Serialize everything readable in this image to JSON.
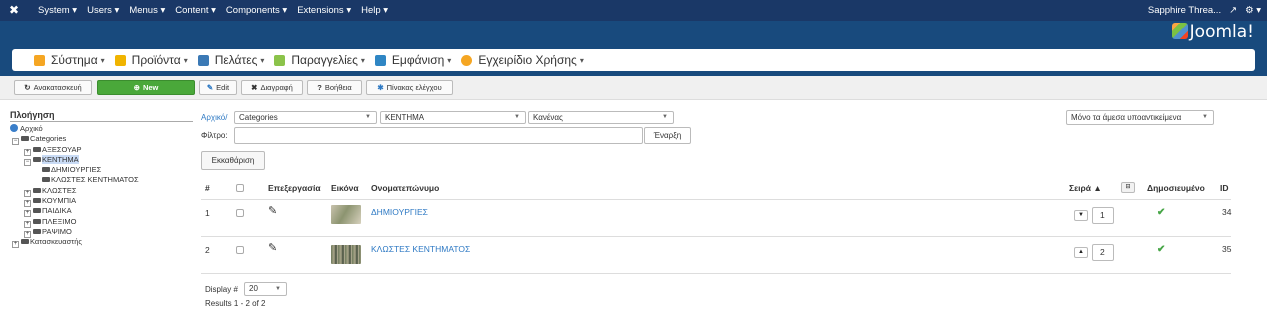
{
  "topbar": {
    "menu": [
      "System ▾",
      "Users ▾",
      "Menus ▾",
      "Content ▾",
      "Components ▾",
      "Extensions ▾",
      "Help ▾"
    ],
    "site_name": "Sapphire Threa...",
    "external_icon": "↗",
    "gear": "⚙ ▾"
  },
  "brand": {
    "name": "Joomla!"
  },
  "nav": {
    "items": [
      {
        "label": "Σύστημα",
        "icon_color": "#f5a623"
      },
      {
        "label": "Προϊόντα",
        "icon_color": "#f0b400"
      },
      {
        "label": "Πελάτες",
        "icon_color": "#3b79b5"
      },
      {
        "label": "Παραγγελίες",
        "icon_color": "#8bc34a"
      },
      {
        "label": "Εμφάνιση",
        "icon_color": "#2f86c4"
      },
      {
        "label": "Εγχειρίδιο Χρήσης",
        "icon_color": "#f5a623"
      }
    ]
  },
  "toolbar": {
    "rebuild": "Ανακατασκευή",
    "new": "New",
    "edit": "Edit",
    "delete": "Διαγραφή",
    "help": "Βοήθεια",
    "control_panel": "Πίνακας ελέγχου"
  },
  "sidebar": {
    "title": "Πλοήγηση",
    "tree": [
      {
        "label": "Αρχικό",
        "depth": 0,
        "type": "globe"
      },
      {
        "label": "Categories",
        "depth": 0,
        "type": "minus"
      },
      {
        "label": "ΑΞΕΣΟΥΑΡ",
        "depth": 1,
        "type": "plus"
      },
      {
        "label": "ΚΕΝΤΗΜΑ",
        "depth": 1,
        "type": "minus",
        "selected": true
      },
      {
        "label": "ΔΗΜΙΟΥΡΓΙΕΣ",
        "depth": 2,
        "type": "leaf"
      },
      {
        "label": "ΚΛΩΣΤΕΣ ΚΕΝΤΗΜΑΤΟΣ",
        "depth": 2,
        "type": "leaf"
      },
      {
        "label": "ΚΛΩΣΤΕΣ",
        "depth": 1,
        "type": "plus"
      },
      {
        "label": "ΚΟΥΜΠΙΑ",
        "depth": 1,
        "type": "plus"
      },
      {
        "label": "ΠΑΙΔΙΚΑ",
        "depth": 1,
        "type": "plus"
      },
      {
        "label": "ΠΛΕΞΙΜΟ",
        "depth": 1,
        "type": "plus"
      },
      {
        "label": "ΡΑΨΙΜΟ",
        "depth": 1,
        "type": "plus"
      },
      {
        "label": "Κατασκευαστής",
        "depth": 0,
        "type": "plus"
      }
    ]
  },
  "filters": {
    "breadcrumb_link": "Αρχικό/",
    "select1": "Categories",
    "select2": "ΚΕΝΤΗΜΑ",
    "select3": "Κανένας",
    "filter_label": "Φίλτρο:",
    "filter_value": "",
    "go": "Έναρξη",
    "clear": "Εκκαθάριση",
    "only_direct": "Μόνο τα άμεσα υποαντικείμενα"
  },
  "table": {
    "headers": {
      "num": "#",
      "edit": "Επεξεργασία",
      "image": "Εικόνα",
      "name": "Ονοματεπώνυμο",
      "order": "Σειρά",
      "published": "Δημοσιευμένο",
      "id": "ID"
    },
    "rows": [
      {
        "num": "1",
        "name": "ΔΗΜΙΟΥΡΓΙΕΣ",
        "order": "1",
        "id": "34",
        "order_arrow": "▼"
      },
      {
        "num": "2",
        "name": "ΚΛΩΣΤΕΣ ΚΕΝΤΗΜΑΤΟΣ",
        "order": "2",
        "id": "35",
        "order_arrow": "▲"
      }
    ]
  },
  "footer": {
    "display_label": "Display #",
    "display_value": "20",
    "results": "Results 1 - 2 of 2"
  }
}
